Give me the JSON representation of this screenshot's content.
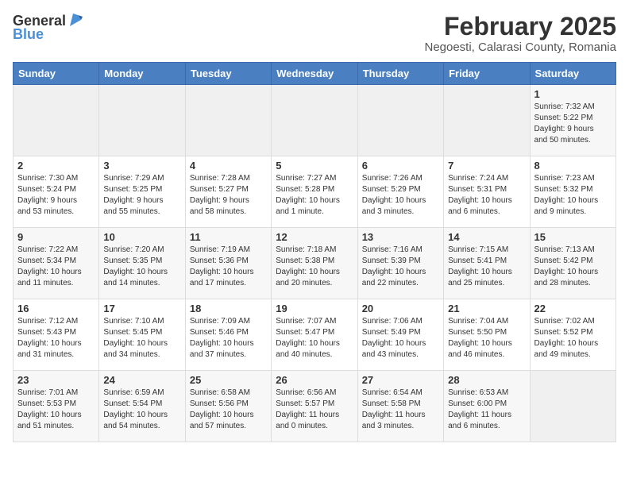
{
  "header": {
    "logo_general": "General",
    "logo_blue": "Blue",
    "month": "February 2025",
    "location": "Negoesti, Calarasi County, Romania"
  },
  "weekdays": [
    "Sunday",
    "Monday",
    "Tuesday",
    "Wednesday",
    "Thursday",
    "Friday",
    "Saturday"
  ],
  "weeks": [
    [
      {
        "day": "",
        "info": ""
      },
      {
        "day": "",
        "info": ""
      },
      {
        "day": "",
        "info": ""
      },
      {
        "day": "",
        "info": ""
      },
      {
        "day": "",
        "info": ""
      },
      {
        "day": "",
        "info": ""
      },
      {
        "day": "1",
        "info": "Sunrise: 7:32 AM\nSunset: 5:22 PM\nDaylight: 9 hours\nand 50 minutes."
      }
    ],
    [
      {
        "day": "2",
        "info": "Sunrise: 7:30 AM\nSunset: 5:24 PM\nDaylight: 9 hours\nand 53 minutes."
      },
      {
        "day": "3",
        "info": "Sunrise: 7:29 AM\nSunset: 5:25 PM\nDaylight: 9 hours\nand 55 minutes."
      },
      {
        "day": "4",
        "info": "Sunrise: 7:28 AM\nSunset: 5:27 PM\nDaylight: 9 hours\nand 58 minutes."
      },
      {
        "day": "5",
        "info": "Sunrise: 7:27 AM\nSunset: 5:28 PM\nDaylight: 10 hours\nand 1 minute."
      },
      {
        "day": "6",
        "info": "Sunrise: 7:26 AM\nSunset: 5:29 PM\nDaylight: 10 hours\nand 3 minutes."
      },
      {
        "day": "7",
        "info": "Sunrise: 7:24 AM\nSunset: 5:31 PM\nDaylight: 10 hours\nand 6 minutes."
      },
      {
        "day": "8",
        "info": "Sunrise: 7:23 AM\nSunset: 5:32 PM\nDaylight: 10 hours\nand 9 minutes."
      }
    ],
    [
      {
        "day": "9",
        "info": "Sunrise: 7:22 AM\nSunset: 5:34 PM\nDaylight: 10 hours\nand 11 minutes."
      },
      {
        "day": "10",
        "info": "Sunrise: 7:20 AM\nSunset: 5:35 PM\nDaylight: 10 hours\nand 14 minutes."
      },
      {
        "day": "11",
        "info": "Sunrise: 7:19 AM\nSunset: 5:36 PM\nDaylight: 10 hours\nand 17 minutes."
      },
      {
        "day": "12",
        "info": "Sunrise: 7:18 AM\nSunset: 5:38 PM\nDaylight: 10 hours\nand 20 minutes."
      },
      {
        "day": "13",
        "info": "Sunrise: 7:16 AM\nSunset: 5:39 PM\nDaylight: 10 hours\nand 22 minutes."
      },
      {
        "day": "14",
        "info": "Sunrise: 7:15 AM\nSunset: 5:41 PM\nDaylight: 10 hours\nand 25 minutes."
      },
      {
        "day": "15",
        "info": "Sunrise: 7:13 AM\nSunset: 5:42 PM\nDaylight: 10 hours\nand 28 minutes."
      }
    ],
    [
      {
        "day": "16",
        "info": "Sunrise: 7:12 AM\nSunset: 5:43 PM\nDaylight: 10 hours\nand 31 minutes."
      },
      {
        "day": "17",
        "info": "Sunrise: 7:10 AM\nSunset: 5:45 PM\nDaylight: 10 hours\nand 34 minutes."
      },
      {
        "day": "18",
        "info": "Sunrise: 7:09 AM\nSunset: 5:46 PM\nDaylight: 10 hours\nand 37 minutes."
      },
      {
        "day": "19",
        "info": "Sunrise: 7:07 AM\nSunset: 5:47 PM\nDaylight: 10 hours\nand 40 minutes."
      },
      {
        "day": "20",
        "info": "Sunrise: 7:06 AM\nSunset: 5:49 PM\nDaylight: 10 hours\nand 43 minutes."
      },
      {
        "day": "21",
        "info": "Sunrise: 7:04 AM\nSunset: 5:50 PM\nDaylight: 10 hours\nand 46 minutes."
      },
      {
        "day": "22",
        "info": "Sunrise: 7:02 AM\nSunset: 5:52 PM\nDaylight: 10 hours\nand 49 minutes."
      }
    ],
    [
      {
        "day": "23",
        "info": "Sunrise: 7:01 AM\nSunset: 5:53 PM\nDaylight: 10 hours\nand 51 minutes."
      },
      {
        "day": "24",
        "info": "Sunrise: 6:59 AM\nSunset: 5:54 PM\nDaylight: 10 hours\nand 54 minutes."
      },
      {
        "day": "25",
        "info": "Sunrise: 6:58 AM\nSunset: 5:56 PM\nDaylight: 10 hours\nand 57 minutes."
      },
      {
        "day": "26",
        "info": "Sunrise: 6:56 AM\nSunset: 5:57 PM\nDaylight: 11 hours\nand 0 minutes."
      },
      {
        "day": "27",
        "info": "Sunrise: 6:54 AM\nSunset: 5:58 PM\nDaylight: 11 hours\nand 3 minutes."
      },
      {
        "day": "28",
        "info": "Sunrise: 6:53 AM\nSunset: 6:00 PM\nDaylight: 11 hours\nand 6 minutes."
      },
      {
        "day": "",
        "info": ""
      }
    ]
  ]
}
